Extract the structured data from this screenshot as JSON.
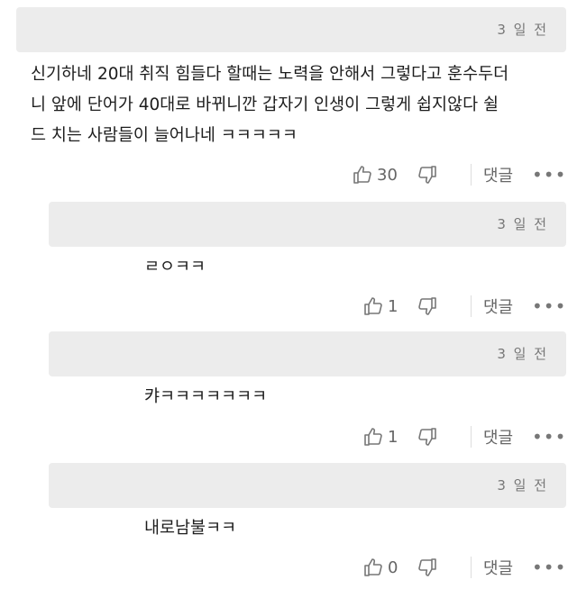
{
  "comments": [
    {
      "time": "3 일 전",
      "text": "신기하네 20대 취직 힘들다 할때는 노력을 안해서 그렇다고 훈수두더\n니 앞에 단어가 40대로 바뀌니깐 갑자기 인생이 그렇게 쉽지않다 쉴\n드 치는 사람들이 늘어나네 ㅋㅋㅋㅋㅋ",
      "likes": "30",
      "reply_label": "댓글",
      "more_label": "•••"
    },
    {
      "time": "3 일 전",
      "text": "ㄹㅇㅋㅋ",
      "likes": "1",
      "reply_label": "댓글",
      "more_label": "•••"
    },
    {
      "time": "3 일 전",
      "text": "캬ㅋㅋㅋㅋㅋㅋㅋ",
      "likes": "1",
      "reply_label": "댓글",
      "more_label": "•••"
    },
    {
      "time": "3 일 전",
      "text": "내로남불ㅋㅋ",
      "likes": "0",
      "reply_label": "댓글",
      "more_label": "•••"
    }
  ],
  "icons": {
    "like": "thumbs-up-icon",
    "dislike": "thumbs-down-icon"
  },
  "colors": {
    "meta_bar": "#ececec",
    "text": "#1d1d1d",
    "muted": "#666666"
  }
}
